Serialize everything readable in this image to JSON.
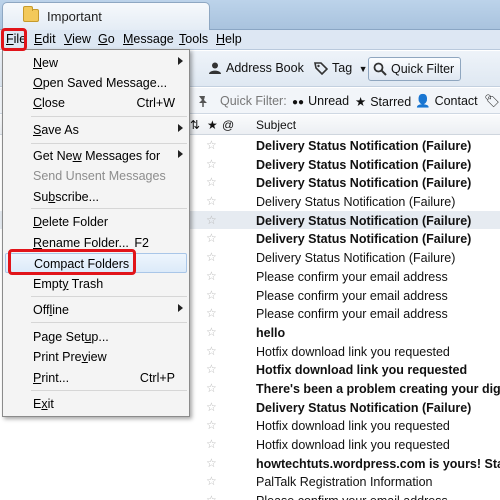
{
  "window": {
    "tab_title": "Important"
  },
  "menubar": {
    "items": [
      {
        "label": "File",
        "key": "F",
        "rest": "ile"
      },
      {
        "label": "Edit",
        "key": "E",
        "rest": "dit"
      },
      {
        "label": "View",
        "key": "V",
        "rest": "iew"
      },
      {
        "label": "Go",
        "key": "G",
        "rest": "o"
      },
      {
        "label": "Message",
        "key": "M",
        "rest": "essage"
      },
      {
        "label": "Tools",
        "key": "T",
        "rest": "ools"
      },
      {
        "label": "Help",
        "key": "H",
        "rest": "elp"
      }
    ]
  },
  "toolbar": {
    "address_book": "Address Book",
    "tag": "Tag",
    "quick_filter": "Quick Filter"
  },
  "quick_filter_bar": {
    "label": "Quick Filter:",
    "unread": "Unread",
    "starred": "Starred",
    "contact": "Contact"
  },
  "columns": {
    "subject": "Subject"
  },
  "file_menu": {
    "items": [
      {
        "label": "New",
        "key": "N",
        "before": "",
        "after": "ew",
        "submenu": true
      },
      {
        "label": "Open Saved Message...",
        "key": "O",
        "before": "",
        "after": "pen Saved Message..."
      },
      {
        "label": "Close",
        "key": "C",
        "before": "",
        "after": "lose",
        "shortcut": "Ctrl+W"
      },
      {
        "label": "Save As",
        "key": "S",
        "before": "",
        "after": "ave As",
        "submenu": true
      },
      {
        "label": "Get New Messages for",
        "key": "w",
        "before": "Get Ne",
        "after": " Messages for",
        "submenu": true
      },
      {
        "label": "Send Unsent Messages",
        "disabled": true
      },
      {
        "label": "Subscribe...",
        "key": "b",
        "before": "Su",
        "after": "scribe..."
      },
      {
        "label": "Delete Folder",
        "key": "D",
        "before": "",
        "after": "elete Folder"
      },
      {
        "label": "Rename Folder...",
        "key": "R",
        "before": "",
        "after": "ename Folder...",
        "shortcut": "F2"
      },
      {
        "label": "Compact Folders",
        "key": "",
        "before": "Compact Folders",
        "after": ""
      },
      {
        "label": "Empty Trash",
        "key": "y",
        "before": "Empt",
        "after": " Trash"
      },
      {
        "label": "Offline",
        "key": "l",
        "before": "Off",
        "after": "ine",
        "submenu": true
      },
      {
        "label": "Page Setup...",
        "key": "u",
        "before": "Page Set",
        "after": "p..."
      },
      {
        "label": "Print Preview",
        "key": "v",
        "before": "Print Pre",
        "after": "iew"
      },
      {
        "label": "Print...",
        "key": "P",
        "before": "",
        "after": "rint...",
        "shortcut": "Ctrl+P"
      },
      {
        "label": "Exit",
        "key": "x",
        "before": "E",
        "after": "it"
      }
    ]
  },
  "messages": [
    {
      "subject": "Delivery Status Notification (Failure)",
      "bold": true
    },
    {
      "subject": "Delivery Status Notification (Failure)",
      "bold": true
    },
    {
      "subject": "Delivery Status Notification (Failure)",
      "bold": true
    },
    {
      "subject": "Delivery Status Notification (Failure)",
      "bold": false
    },
    {
      "subject": "Delivery Status Notification (Failure)",
      "bold": true,
      "highlight": true
    },
    {
      "subject": "Delivery Status Notification (Failure)",
      "bold": true
    },
    {
      "subject": "Delivery Status Notification (Failure)",
      "bold": false
    },
    {
      "subject": "Please confirm your email address",
      "bold": false
    },
    {
      "subject": "Please confirm your email address",
      "bold": false
    },
    {
      "subject": "Please confirm your email address",
      "bold": false
    },
    {
      "subject": "hello",
      "bold": true
    },
    {
      "subject": "Hotfix download link you requested",
      "bold": false
    },
    {
      "subject": "Hotfix download link you requested",
      "bold": true
    },
    {
      "subject": "There's been a problem creating your digital pu",
      "bold": true
    },
    {
      "subject": "Delivery Status Notification (Failure)",
      "bold": true
    },
    {
      "subject": "Hotfix download link you requested",
      "bold": false
    },
    {
      "subject": "Hotfix download link you requested",
      "bold": false
    },
    {
      "subject": "howtechtuts.wordpress.com is yours! Start cust",
      "bold": true
    },
    {
      "subject": "PalTalk Registration Information",
      "bold": false
    },
    {
      "subject": "Please confirm your email address",
      "bold": false
    }
  ],
  "colors": {
    "annotation": "#e1141a",
    "menu_bg": "#f4f4f4",
    "accent": "#a9c6e8"
  }
}
